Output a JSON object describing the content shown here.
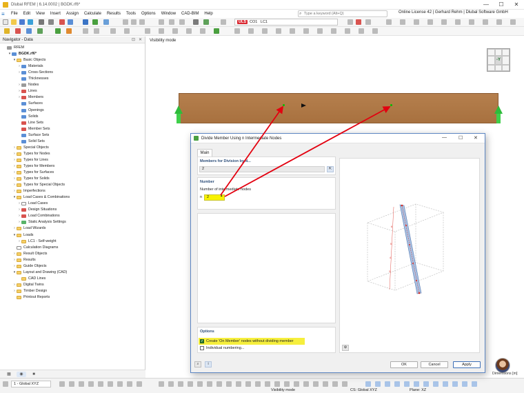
{
  "window": {
    "title": "Dlubal RFEM | 6.14.0002 | BGDK.rf6*",
    "controls": [
      "—",
      "☐",
      "✕"
    ]
  },
  "menu": {
    "items": [
      "File",
      "Edit",
      "View",
      "Insert",
      "Assign",
      "Calculate",
      "Results",
      "Tools",
      "Options",
      "Window",
      "CAD-BIM",
      "Help"
    ],
    "search_placeholder": "Type a keyword (Alt+Q)",
    "license": "Online License 42 | Gerhard Rehm | Dlubal Software GmbH"
  },
  "toolbar": {
    "uls": "ULS",
    "combo_co": "CO1",
    "combo_lc": "LC1"
  },
  "navigator": {
    "title": "Navigator - Data",
    "items": [
      {
        "label": "RFEM",
        "indent": 0,
        "icon": "gray",
        "arrow": ""
      },
      {
        "label": "BGDK.rf6*",
        "indent": 1,
        "icon": "blue",
        "arrow": "▾",
        "bold": true
      },
      {
        "label": "Basic Objects",
        "indent": 2,
        "icon": "folder",
        "arrow": "▾"
      },
      {
        "label": "Materials",
        "indent": 3,
        "icon": "blue",
        "arrow": "›"
      },
      {
        "label": "Cross-Sections",
        "indent": 3,
        "icon": "blue",
        "arrow": "›"
      },
      {
        "label": "Thicknesses",
        "indent": 3,
        "icon": "blue",
        "arrow": ""
      },
      {
        "label": "Nodes",
        "indent": 3,
        "icon": "gray",
        "arrow": "›"
      },
      {
        "label": "Lines",
        "indent": 3,
        "icon": "red",
        "arrow": "›"
      },
      {
        "label": "Members",
        "indent": 3,
        "icon": "red",
        "arrow": "›"
      },
      {
        "label": "Surfaces",
        "indent": 3,
        "icon": "blue",
        "arrow": ""
      },
      {
        "label": "Openings",
        "indent": 3,
        "icon": "blue",
        "arrow": ""
      },
      {
        "label": "Solids",
        "indent": 3,
        "icon": "blue",
        "arrow": ""
      },
      {
        "label": "Line Sets",
        "indent": 3,
        "icon": "red",
        "arrow": ""
      },
      {
        "label": "Member Sets",
        "indent": 3,
        "icon": "red",
        "arrow": ""
      },
      {
        "label": "Surface Sets",
        "indent": 3,
        "icon": "blue",
        "arrow": ""
      },
      {
        "label": "Solid Sets",
        "indent": 3,
        "icon": "blue",
        "arrow": ""
      },
      {
        "label": "Special Objects",
        "indent": 2,
        "icon": "folder",
        "arrow": "›"
      },
      {
        "label": "Types for Nodes",
        "indent": 2,
        "icon": "folder",
        "arrow": "›"
      },
      {
        "label": "Types for Lines",
        "indent": 2,
        "icon": "folder",
        "arrow": "›"
      },
      {
        "label": "Types for Members",
        "indent": 2,
        "icon": "folder",
        "arrow": "›"
      },
      {
        "label": "Types for Surfaces",
        "indent": 2,
        "icon": "folder",
        "arrow": "›"
      },
      {
        "label": "Types for Solids",
        "indent": 2,
        "icon": "folder",
        "arrow": "›"
      },
      {
        "label": "Types for Special Objects",
        "indent": 2,
        "icon": "folder",
        "arrow": "›"
      },
      {
        "label": "Imperfections",
        "indent": 2,
        "icon": "folder",
        "arrow": "›"
      },
      {
        "label": "Load Cases & Combinations",
        "indent": 2,
        "icon": "folder",
        "arrow": "▾"
      },
      {
        "label": "Load Cases",
        "indent": 3,
        "icon": "file",
        "arrow": "›"
      },
      {
        "label": "Design Situations",
        "indent": 3,
        "icon": "red",
        "arrow": "›"
      },
      {
        "label": "Load Combinations",
        "indent": 3,
        "icon": "red",
        "arrow": "›"
      },
      {
        "label": "Static Analysis Settings",
        "indent": 3,
        "icon": "green",
        "arrow": "›"
      },
      {
        "label": "Load Wizards",
        "indent": 2,
        "icon": "folder",
        "arrow": "›"
      },
      {
        "label": "Loads",
        "indent": 2,
        "icon": "folder",
        "arrow": "▾"
      },
      {
        "label": "LC1 - Self-weight",
        "indent": 3,
        "icon": "folder",
        "arrow": "›"
      },
      {
        "label": "Calculation Diagrams",
        "indent": 2,
        "icon": "file",
        "arrow": ""
      },
      {
        "label": "Result Objects",
        "indent": 2,
        "icon": "folder",
        "arrow": "›"
      },
      {
        "label": "Results",
        "indent": 2,
        "icon": "folder",
        "arrow": "›"
      },
      {
        "label": "Guide Objects",
        "indent": 2,
        "icon": "folder",
        "arrow": "›"
      },
      {
        "label": "Layout and Drawing (CAD)",
        "indent": 2,
        "icon": "folder",
        "arrow": "▾"
      },
      {
        "label": "CAD Lines",
        "indent": 3,
        "icon": "folder",
        "arrow": ""
      },
      {
        "label": "Digital Twins",
        "indent": 2,
        "icon": "folder",
        "arrow": "›"
      },
      {
        "label": "Timber Design",
        "indent": 2,
        "icon": "folder",
        "arrow": "›"
      },
      {
        "label": "Printout Reports",
        "indent": 2,
        "icon": "folder",
        "arrow": ""
      }
    ]
  },
  "viewport": {
    "mode_label": "Visibility mode",
    "navcube_label": "-Y",
    "dimension_text": "Dimensions [m]"
  },
  "dialog": {
    "title": "Divide Member Using n Intermediate Nodes",
    "tab_main": "Main",
    "members_header": "Members for Division by N...",
    "members_value": "2",
    "number_header": "Number",
    "intermediate_label": "Number of intermediate nodes",
    "n_label": "n",
    "n_value": "2",
    "options_header": "Options",
    "option1": "Create 'On Member' nodes without dividing member",
    "option1_checked": true,
    "option2": "Individual numbering...",
    "option2_checked": false,
    "ok": "OK",
    "cancel": "Cancel",
    "apply": "Apply"
  },
  "statusbar": {
    "cs_combo": "1 - Global XYZ",
    "mode": "Visibility mode",
    "cs": "CS: Global XYZ",
    "plane": "Plane: XZ"
  },
  "colors": {
    "arrow": "#e3000f",
    "beam": "#ad7544",
    "support": "#2ebc3b",
    "accent": "#1b6ec2"
  }
}
